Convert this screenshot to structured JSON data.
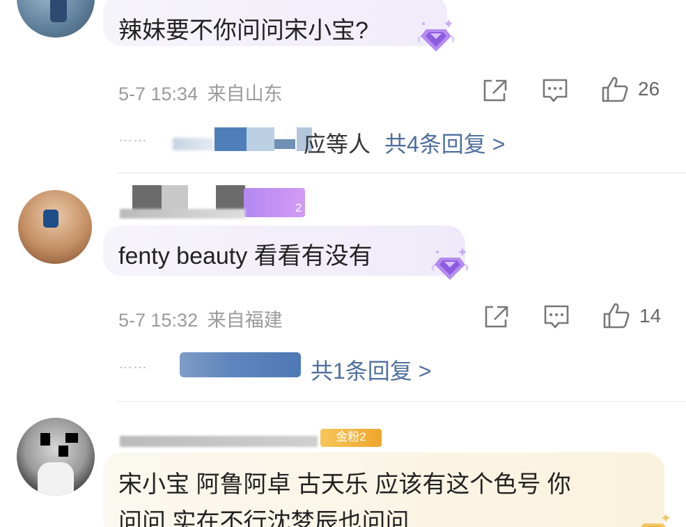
{
  "comments": [
    {
      "text": "辣妹要不你问问宋小宝?",
      "time": "5-7 15:34",
      "location": "来自山东",
      "likes": "26",
      "reply_preview_tail": "应等人",
      "reply_count_label": "共4条回复 >"
    },
    {
      "badge_level": "2",
      "text": "fenty beauty 看看有没有",
      "time": "5-7 15:32",
      "location": "来自福建",
      "likes": "14",
      "reply_count_label": "共1条回复 >"
    },
    {
      "badge_label": "金粉2",
      "text_line1": "宋小宝  阿鲁阿卓  古天乐 应该有这个色号  你",
      "text_line2": "问问 实在不行沈梦辰也问问"
    }
  ],
  "ui": {
    "reply_dots": "……",
    "accent_color": "#4f6f9f",
    "meta_color": "#9a9a9a",
    "icons": [
      "share-icon",
      "comment-icon",
      "thumbs-up-icon",
      "diamond-badge-icon"
    ]
  }
}
